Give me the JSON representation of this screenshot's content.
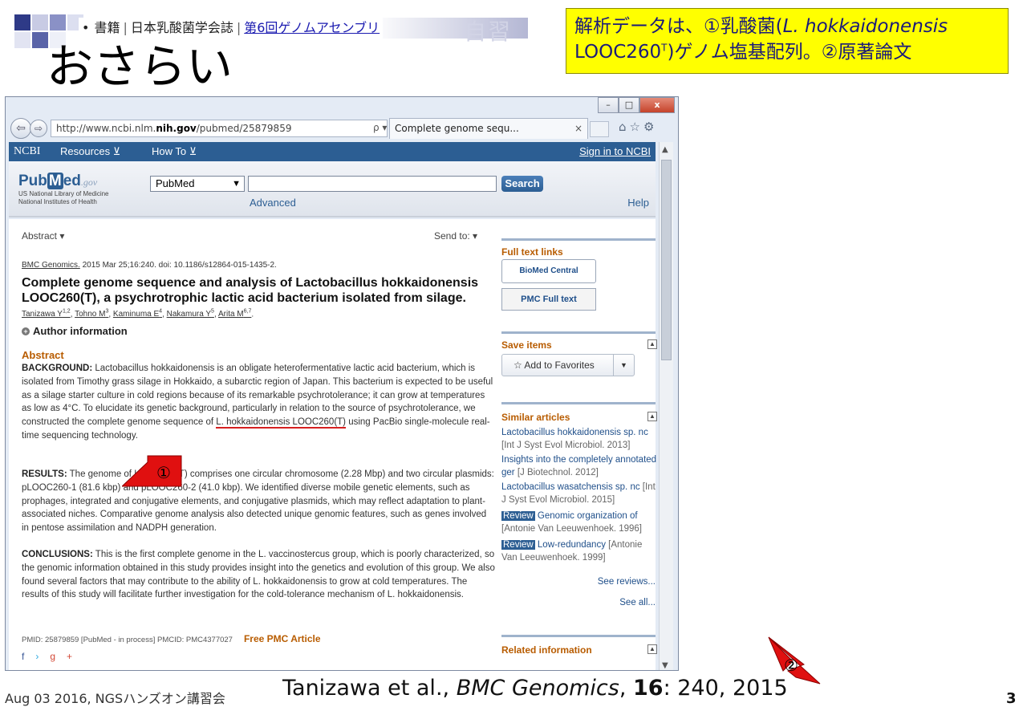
{
  "slide": {
    "breadcrumb_bullet": "•",
    "breadcrumb_item1": "書籍",
    "breadcrumb_item2": "日本乳酸菌学会誌",
    "breadcrumb_item3": "第6回ゲノムアセンブリ",
    "ghost_label": "自習",
    "title": "おさらい",
    "note_line1_a": "解析データは、①乳酸菌(",
    "note_line1_italic": "L. hokkaidonensis",
    "note_line2_a": "LOOC260",
    "note_line2_sup": "T",
    "note_line2_b": ")ゲノム塩基配列。②原著論文",
    "citation_a": "Tanizawa et al., ",
    "citation_journal": "BMC Genomics",
    "citation_sep": ", ",
    "citation_volume": "16",
    "citation_rest": ": 240, 2015",
    "footer_date": "Aug 03 2016, NGSハンズオン講習会",
    "page_number": "3",
    "callout_1": "①",
    "callout_2": "②"
  },
  "browser": {
    "win_min": "–",
    "win_max": "□",
    "win_close": "x",
    "back_icon": "⇦",
    "fwd_icon": "⇨",
    "url_prefix": "http://www.ncbi.nlm.",
    "url_bold": "nih.gov",
    "url_suffix": "/pubmed/25879859",
    "url_tools": "ρ ▾ ↻",
    "tab_title": "Complete genome sequ...",
    "tab_close": "×",
    "icons": "⌂☆⚙"
  },
  "ncbi": {
    "logo": "NCBI",
    "menu_resources": "Resources ⊻",
    "menu_howto": "How To ⊻",
    "signin": "Sign in to NCBI",
    "pubmed_logo_a": "Pub",
    "pubmed_logo_m": "M",
    "pubmed_logo_b": "ed",
    "pubmed_logo_gov": ".gov",
    "nlm_line1": "US National Library of Medicine",
    "nlm_line2": "National Institutes of Health",
    "db_selected": "PubMed",
    "search_button": "Search",
    "advanced": "Advanced",
    "help": "Help"
  },
  "article": {
    "abstract_dropdown": "Abstract ▾",
    "send_to": "Send to: ▾",
    "journal_name": "BMC Genomics.",
    "journal_details": " 2015 Mar 25;16:240. doi: 10.1186/s12864-015-1435-2.",
    "title": "Complete genome sequence and analysis of Lactobacillus hokkaidonensis LOOC260(T), a psychrotrophic lactic acid bacterium isolated from silage.",
    "authors": [
      {
        "name": "Tanizawa Y",
        "sup": "1,2"
      },
      {
        "name": "Tohno M",
        "sup": "3"
      },
      {
        "name": "Kaminuma E",
        "sup": "4"
      },
      {
        "name": "Nakamura Y",
        "sup": "5"
      },
      {
        "name": "Arita M",
        "sup": "6,7"
      }
    ],
    "author_info": "Author information",
    "abstract_heading": "Abstract",
    "background_label": "BACKGROUND:",
    "background_text_a": " Lactobacillus hokkaidonensis is an obligate heterofermentative lactic acid bacterium, which is isolated from Timothy grass silage in Hokkaido, a subarctic region of Japan. This bacterium is expected to be useful as a silage starter culture in cold regions because of its remarkable psychrotolerance; it can grow at temperatures as low as 4°C. To elucidate its genetic background, particularly in relation to the source of psychrotolerance, we constructed the complete genome sequence of ",
    "background_highlight": "L. hokkaidonensis LOOC260(T)",
    "background_text_b": " using PacBio single-molecule real-time sequencing technology.",
    "results_label": "RESULTS:",
    "results_text": " The genome of LOOC260(T) comprises one circular chromosome (2.28 Mbp) and two circular plasmids: pLOOC260-1 (81.6 kbp) and pLOOC260-2 (41.0 kbp). We identified diverse mobile genetic elements, such as prophages, integrated and conjugative elements, and conjugative plasmids, which may reflect adaptation to plant-associated niches. Comparative genome analysis also detected unique genomic features, such as genes involved in pentose assimilation and NADPH generation.",
    "conclusions_label": "CONCLUSIONS:",
    "conclusions_text": " This is the first complete genome in the L. vaccinostercus group, which is poorly characterized, so the genomic information obtained in this study provides insight into the genetics and evolution of this group. We also found several factors that may contribute to the ability of L. hokkaidonensis to grow at cold temperatures. The results of this study will facilitate further investigation for the cold-tolerance mechanism of L. hokkaidonensis.",
    "pmid_line": "PMID: 25879859 [PubMed - in process]   PMCID: PMC4377027",
    "free_pmc": "Free PMC Article",
    "social": "f",
    "social_tw": "›",
    "social_gp": "g+"
  },
  "sidebar": {
    "full_text_links": "Full text links",
    "biomed_badge": "BioMed Central",
    "pmc_badge": "PMC Full text",
    "save_items": "Save items",
    "add_favorites": "☆  Add to Favorites",
    "similar_articles": "Similar articles",
    "similar": [
      {
        "title": "Lactobacillus hokkaidonensis sp. nc",
        "source": " [Int J Syst Evol Microbiol. 2013]",
        "review": ""
      },
      {
        "title": "Insights into the completely annotated ger",
        "source": " [J Biotechnol. 2012]",
        "review": ""
      },
      {
        "title": "Lactobacillus wasatchensis sp. nc",
        "source": " [Int J Syst Evol Microbiol. 2015]",
        "review": ""
      },
      {
        "title": " Genomic organization of",
        "source": " [Antonie Van Leeuwenhoek. 1996]",
        "review": "Review"
      },
      {
        "title": " Low-redundancy",
        "source": " [Antonie Van Leeuwenhoek. 1999]",
        "review": "Review"
      }
    ],
    "see_reviews": "See reviews...",
    "see_all": "See all...",
    "related_information": "Related information",
    "collapse_icon": "▲"
  },
  "colors": {
    "ncbi_blue": "#2c5e93",
    "heading_orange": "#b85c00",
    "note_yellow": "#ffff00",
    "callout_red": "#e01010"
  }
}
